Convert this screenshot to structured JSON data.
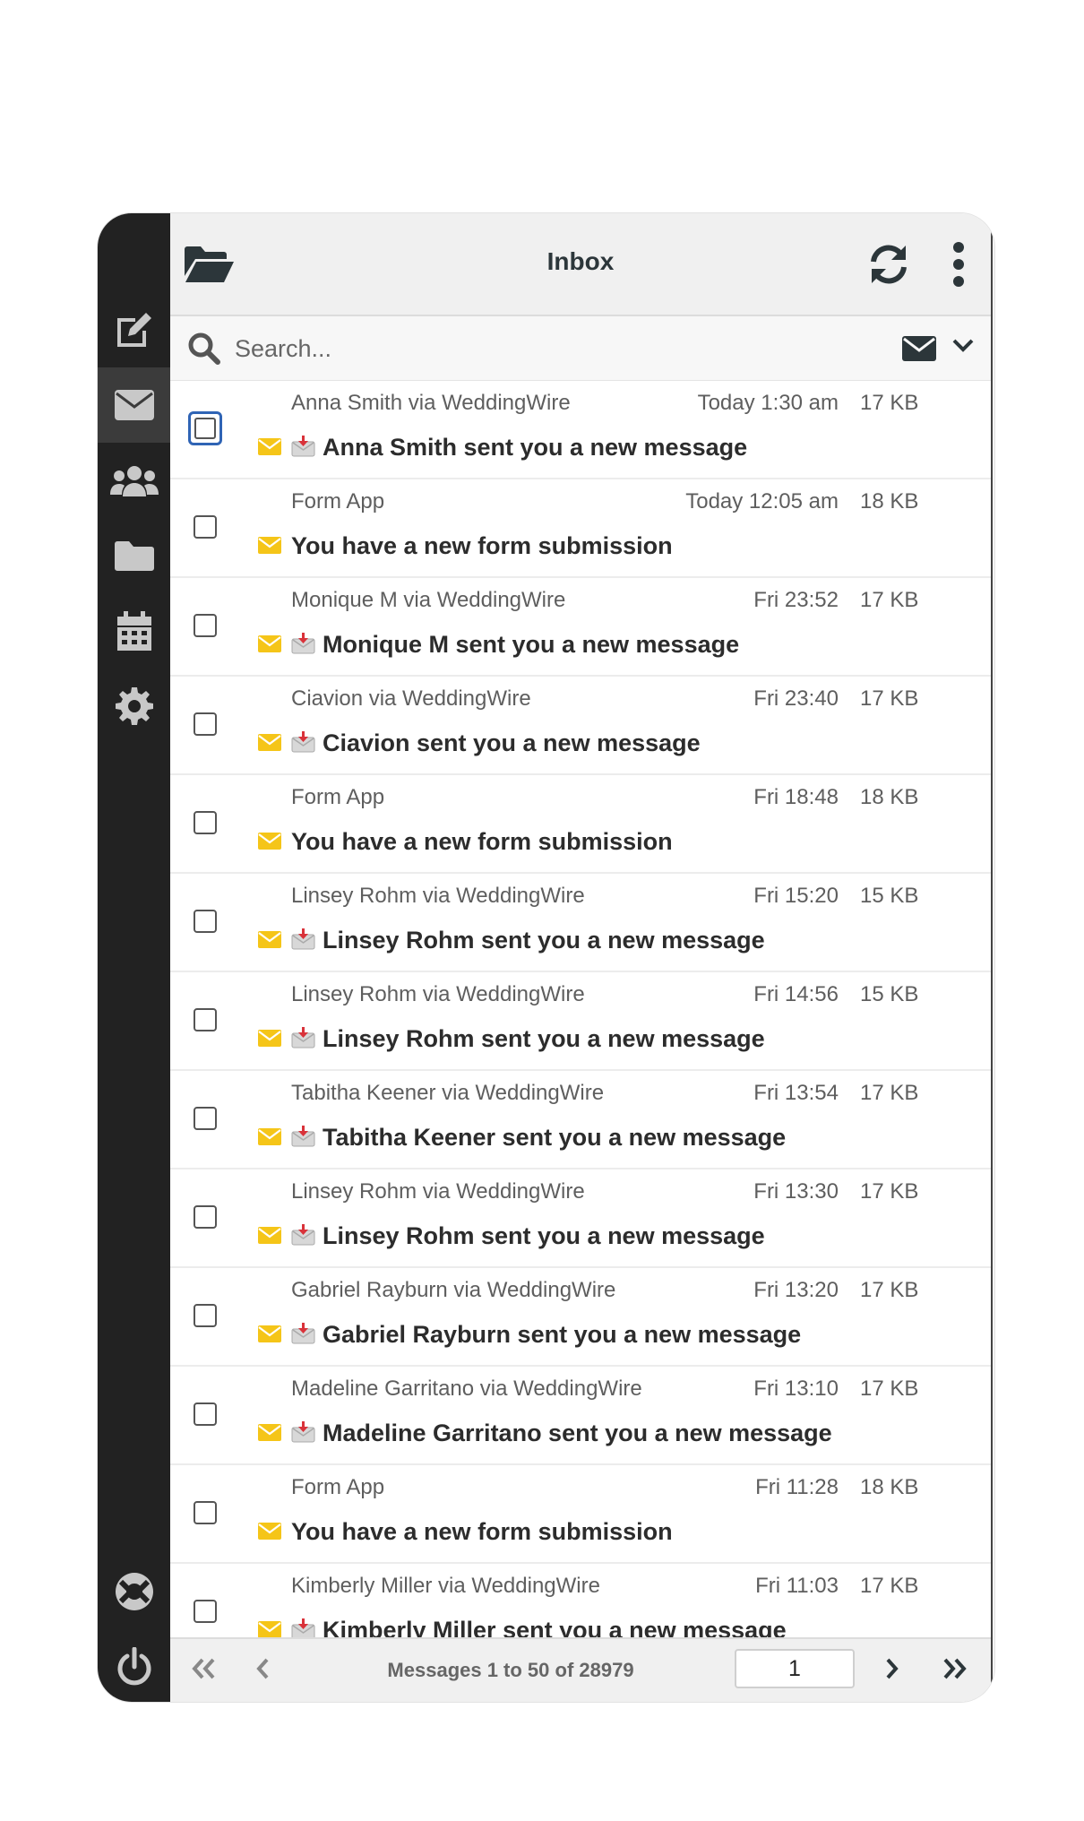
{
  "header": {
    "title": "Inbox"
  },
  "search": {
    "placeholder": "Search..."
  },
  "sidebar": {
    "items": [
      {
        "name": "compose",
        "icon": "compose-icon"
      },
      {
        "name": "mail",
        "icon": "envelope-icon",
        "active": true
      },
      {
        "name": "contacts",
        "icon": "users-icon"
      },
      {
        "name": "files",
        "icon": "folder-icon"
      },
      {
        "name": "calendar",
        "icon": "calendar-icon"
      },
      {
        "name": "settings",
        "icon": "gear-icon"
      },
      {
        "name": "help",
        "icon": "lifebuoy-icon"
      },
      {
        "name": "logout",
        "icon": "power-icon"
      }
    ]
  },
  "messages": [
    {
      "from": "Anna Smith via WeddingWire",
      "date": "Today 1:30 am",
      "size": "17 KB",
      "subject": "Anna Smith sent you a new message",
      "has_emoji": true
    },
    {
      "from": "Form App",
      "date": "Today 12:05 am",
      "size": "18 KB",
      "subject": "You have a new form submission",
      "has_emoji": false
    },
    {
      "from": "Monique M via WeddingWire",
      "date": "Fri 23:52",
      "size": "17 KB",
      "subject": "Monique M sent you a new message",
      "has_emoji": true
    },
    {
      "from": "Ciavion via WeddingWire",
      "date": "Fri 23:40",
      "size": "17 KB",
      "subject": "Ciavion sent you a new message",
      "has_emoji": true
    },
    {
      "from": "Form App",
      "date": "Fri 18:48",
      "size": "18 KB",
      "subject": "You have a new form submission",
      "has_emoji": false
    },
    {
      "from": "Linsey Rohm via WeddingWire",
      "date": "Fri 15:20",
      "size": "15 KB",
      "subject": "Linsey Rohm sent you a new message",
      "has_emoji": true
    },
    {
      "from": "Linsey Rohm via WeddingWire",
      "date": "Fri 14:56",
      "size": "15 KB",
      "subject": "Linsey Rohm sent you a new message",
      "has_emoji": true
    },
    {
      "from": "Tabitha Keener via WeddingWire",
      "date": "Fri 13:54",
      "size": "17 KB",
      "subject": "Tabitha Keener sent you a new message",
      "has_emoji": true
    },
    {
      "from": "Linsey Rohm via WeddingWire",
      "date": "Fri 13:30",
      "size": "17 KB",
      "subject": "Linsey Rohm sent you a new message",
      "has_emoji": true
    },
    {
      "from": "Gabriel Rayburn via WeddingWire",
      "date": "Fri 13:20",
      "size": "17 KB",
      "subject": "Gabriel Rayburn sent you a new message",
      "has_emoji": true
    },
    {
      "from": "Madeline Garritano via WeddingWire",
      "date": "Fri 13:10",
      "size": "17 KB",
      "subject": "Madeline Garritano sent you a new message",
      "has_emoji": true
    },
    {
      "from": "Form App",
      "date": "Fri 11:28",
      "size": "18 KB",
      "subject": "You have a new form submission",
      "has_emoji": false
    },
    {
      "from": "Kimberly Miller via WeddingWire",
      "date": "Fri 11:03",
      "size": "17 KB",
      "subject": "Kimberly Miller sent you a new message",
      "has_emoji": true
    }
  ],
  "footer": {
    "count_text": "Messages 1 to 50 of 28979",
    "page": "1"
  },
  "colors": {
    "sidebar": "#222222",
    "unread_icon": "#f5c518",
    "focus": "#2f64b5"
  }
}
